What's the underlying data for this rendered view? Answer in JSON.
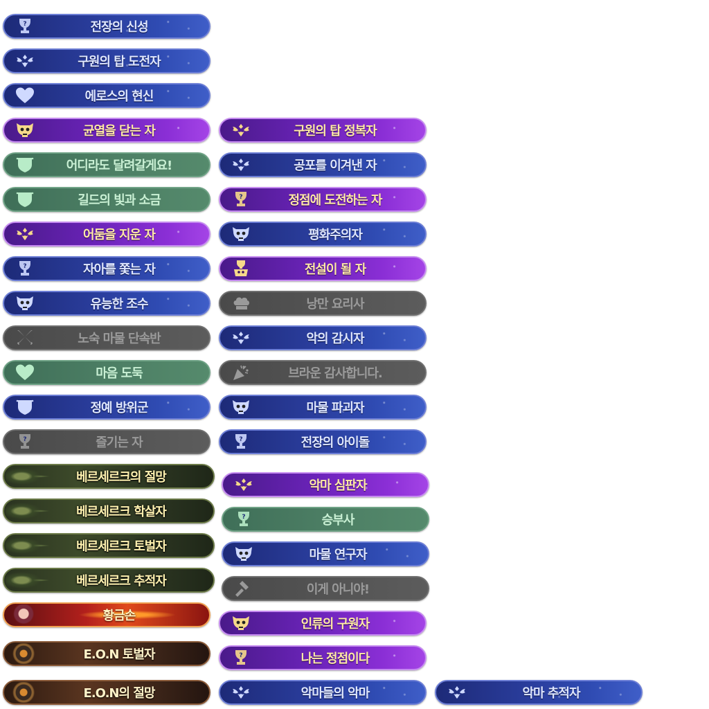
{
  "badges": [
    {
      "label": "전장의 신성",
      "theme": "blue",
      "icon": "trophy-question-icon"
    },
    {
      "label": "구원의 탑 도전자",
      "theme": "blue",
      "icon": "winged-emblem-icon"
    },
    {
      "label": "에로스의 현신",
      "theme": "blue",
      "icon": "heart-icon"
    },
    {
      "label": "균열을 닫는 자",
      "theme": "purple",
      "icon": "skull-icon"
    },
    {
      "label": "구원의 탑 정복자",
      "theme": "purple",
      "icon": "winged-emblem-icon"
    },
    {
      "label": "어디라도 달려갈게요!",
      "theme": "green",
      "icon": "shield-icon"
    },
    {
      "label": "공포를 이겨낸 자",
      "theme": "blue",
      "icon": "winged-emblem-icon"
    },
    {
      "label": "길드의 빛과 소금",
      "theme": "green",
      "icon": "shield-icon"
    },
    {
      "label": "정점에 도전하는 자",
      "theme": "purple",
      "icon": "trophy-question-icon"
    },
    {
      "label": "어둠을 지운 자",
      "theme": "purple",
      "icon": "winged-emblem-icon"
    },
    {
      "label": "평화주의자",
      "theme": "blue",
      "icon": "skull-icon"
    },
    {
      "label": "자아를 쫓는 자",
      "theme": "blue",
      "icon": "trophy-question-icon"
    },
    {
      "label": "전설이 될 자",
      "theme": "purple",
      "icon": "trophy-skull-icon"
    },
    {
      "label": "유능한 조수",
      "theme": "blue",
      "icon": "skull-icon"
    },
    {
      "label": "낭만 요리사",
      "theme": "gray",
      "icon": "chef-hat-icon"
    },
    {
      "label": "노숙 마물 단속반",
      "theme": "gray",
      "icon": "crossed-swords-icon"
    },
    {
      "label": "악의 감시자",
      "theme": "blue",
      "icon": "winged-emblem-icon"
    },
    {
      "label": "마음 도둑",
      "theme": "green",
      "icon": "heart-icon"
    },
    {
      "label": "브라운 감사합니다.",
      "theme": "gray",
      "icon": "party-popper-icon"
    },
    {
      "label": "정예 방위군",
      "theme": "blue",
      "icon": "shield-icon"
    },
    {
      "label": "마물 파괴자",
      "theme": "blue",
      "icon": "skull-icon"
    },
    {
      "label": "즐기는 자",
      "theme": "gray",
      "icon": "trophy-question-icon"
    },
    {
      "label": "전장의 아이돌",
      "theme": "blue",
      "icon": "trophy-question-icon"
    },
    {
      "label": "베르세르크의 절망",
      "theme": "berserk",
      "icon": "berserk-portrait-icon"
    },
    {
      "label": "악마 심판자",
      "theme": "purple",
      "icon": "winged-emblem-icon"
    },
    {
      "label": "베르세르크 학살자",
      "theme": "berserk",
      "icon": "berserk-portrait-icon"
    },
    {
      "label": "승부사",
      "theme": "green",
      "icon": "trophy-question-icon"
    },
    {
      "label": "베르세르크 토벌자",
      "theme": "berserk",
      "icon": "berserk-portrait-icon"
    },
    {
      "label": "마물 연구자",
      "theme": "blue",
      "icon": "skull-icon"
    },
    {
      "label": "베르세르크 추적자",
      "theme": "berserk",
      "icon": "berserk-portrait-icon"
    },
    {
      "label": "이게 아니야!",
      "theme": "gray",
      "icon": "hammer-icon"
    },
    {
      "label": "황금손",
      "theme": "gold",
      "icon": "character-portrait-icon"
    },
    {
      "label": "인류의 구원자",
      "theme": "purple",
      "icon": "skull-icon"
    },
    {
      "label": "E.O.N 토벌자",
      "theme": "eon",
      "icon": "eon-portrait-icon"
    },
    {
      "label": "나는 정점이다",
      "theme": "purple",
      "icon": "trophy-question-icon"
    },
    {
      "label": "E.O.N의 절망",
      "theme": "eon",
      "icon": "eon-portrait-icon"
    },
    {
      "label": "악마들의 악마",
      "theme": "blue",
      "icon": "winged-emblem-icon"
    },
    {
      "label": "악마 추적자",
      "theme": "blue",
      "icon": "winged-emblem-icon"
    }
  ]
}
